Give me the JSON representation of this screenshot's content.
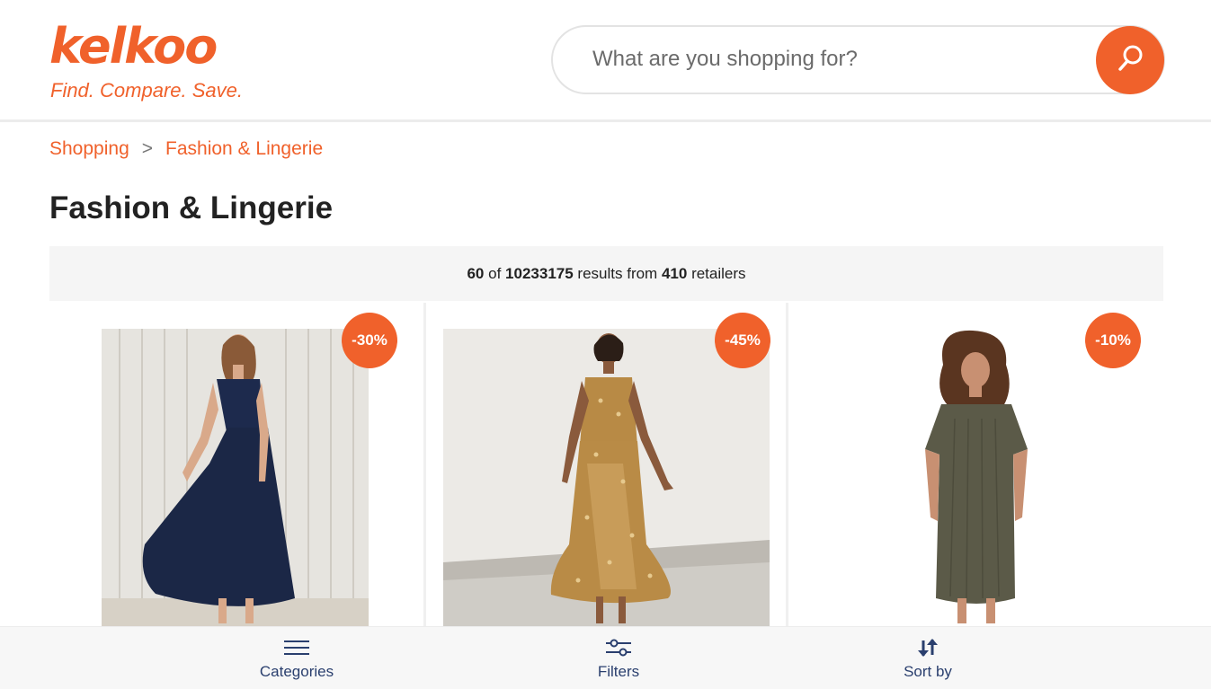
{
  "brand": {
    "name": "kelkoo",
    "tagline": "Find. Compare. Save.",
    "accent_color": "#f0612b"
  },
  "search": {
    "placeholder": "What are you shopping for?",
    "button_icon": "search-icon"
  },
  "breadcrumb": {
    "items": [
      "Shopping",
      "Fashion & Lingerie"
    ],
    "separator": ">"
  },
  "page": {
    "title": "Fashion & Lingerie"
  },
  "results": {
    "shown": "60",
    "of_label": "of",
    "total": "10233175",
    "results_from_label": "results from",
    "retailers": "410",
    "retailers_label": "retailers"
  },
  "products": [
    {
      "discount": "-30%",
      "image": "navy maxi dress"
    },
    {
      "discount": "-45%",
      "image": "gold satin polka dot slip dress"
    },
    {
      "discount": "-10%",
      "image": "khaki ribbed t-shirt dress"
    }
  ],
  "bottom_nav": {
    "categories": {
      "label": "Categories",
      "icon": "menu-icon"
    },
    "filters": {
      "label": "Filters",
      "icon": "sliders-icon"
    },
    "sort": {
      "label": "Sort by",
      "icon": "sort-arrows-icon"
    },
    "text_color": "#2a3f6e"
  }
}
